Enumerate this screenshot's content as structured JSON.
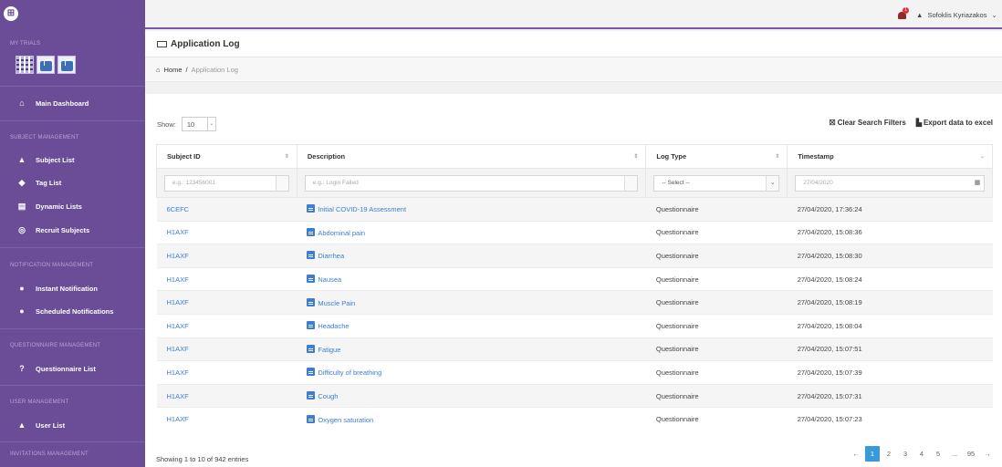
{
  "sidebar": {
    "logo_glyph": "⊞",
    "section_my_trials": "MY TRIALS",
    "main_dashboard": "Main Dashboard",
    "section_subject_management": "SUBJECT MANAGEMENT",
    "subject_list": "Subject List",
    "tag_list": "Tag List",
    "dynamic_lists": "Dynamic Lists",
    "recruit_subjects": "Recruit Subjects",
    "section_notification_management": "NOTIFICATION MANAGEMENT",
    "instant_notification": "Instant Notification",
    "scheduled_notifications": "Scheduled Notifications",
    "section_questionnaire_management": "QUESTIONNAIRE MANAGEMENT",
    "questionnaire_list": "Questionnaire List",
    "section_user_management": "USER MANAGEMENT",
    "user_list": "User List",
    "section_invitations_management": "INVITATIONS MANAGEMENT"
  },
  "topbar": {
    "notification_count": "1",
    "user_name": "Sofoklis Kyriazakos"
  },
  "page": {
    "title": "Application Log",
    "breadcrumb_home": "Home",
    "breadcrumb_sep": "/",
    "breadcrumb_current": "Application Log"
  },
  "toolbar": {
    "show_label": "Show:",
    "show_value": "10",
    "clear_filters": "Clear Search Filters",
    "export_excel": "Export data to excel"
  },
  "table": {
    "headers": [
      "Subject ID",
      "Description",
      "Log Type",
      "Timestamp"
    ],
    "filters": {
      "subject_placeholder": "e.g.: 123456001",
      "description_placeholder": "e.g.: Login Failed",
      "logtype_value": "-- Select --",
      "timestamp_value": "27/04/2020"
    },
    "rows": [
      {
        "subject": "6CEFC",
        "description": "Initial COVID-19 Assessment",
        "type": "Questionnaire",
        "timestamp": "27/04/2020, 17:36:24"
      },
      {
        "subject": "H1AXF",
        "description": "Abdominal pain",
        "type": "Questionnaire",
        "timestamp": "27/04/2020, 15:08:36"
      },
      {
        "subject": "H1AXF",
        "description": "Diarrhea",
        "type": "Questionnaire",
        "timestamp": "27/04/2020, 15:08:30"
      },
      {
        "subject": "H1AXF",
        "description": "Nausea",
        "type": "Questionnaire",
        "timestamp": "27/04/2020, 15:08:24"
      },
      {
        "subject": "H1AXF",
        "description": "Muscle Pain",
        "type": "Questionnaire",
        "timestamp": "27/04/2020, 15:08:19"
      },
      {
        "subject": "H1AXF",
        "description": "Headache",
        "type": "Questionnaire",
        "timestamp": "27/04/2020, 15:08:04"
      },
      {
        "subject": "H1AXF",
        "description": "Fatigue",
        "type": "Questionnaire",
        "timestamp": "27/04/2020, 15:07:51"
      },
      {
        "subject": "H1AXF",
        "description": "Difficulty of breathing",
        "type": "Questionnaire",
        "timestamp": "27/04/2020, 15:07:39"
      },
      {
        "subject": "H1AXF",
        "description": "Cough",
        "type": "Questionnaire",
        "timestamp": "27/04/2020, 15:07:31"
      },
      {
        "subject": "H1AXF",
        "description": "Oxygen saturation",
        "type": "Questionnaire",
        "timestamp": "27/04/2020, 15:07:23"
      }
    ]
  },
  "footer": {
    "info": "Showing 1 to 10 of 942 entries",
    "pages": [
      "←",
      "1",
      "2",
      "3",
      "4",
      "5",
      "...",
      "95",
      "→"
    ],
    "active_page": "1"
  },
  "colors": {
    "sidebar": "#6a4c97",
    "link": "#3a7fd5",
    "pager_active": "#3a9ad9"
  }
}
